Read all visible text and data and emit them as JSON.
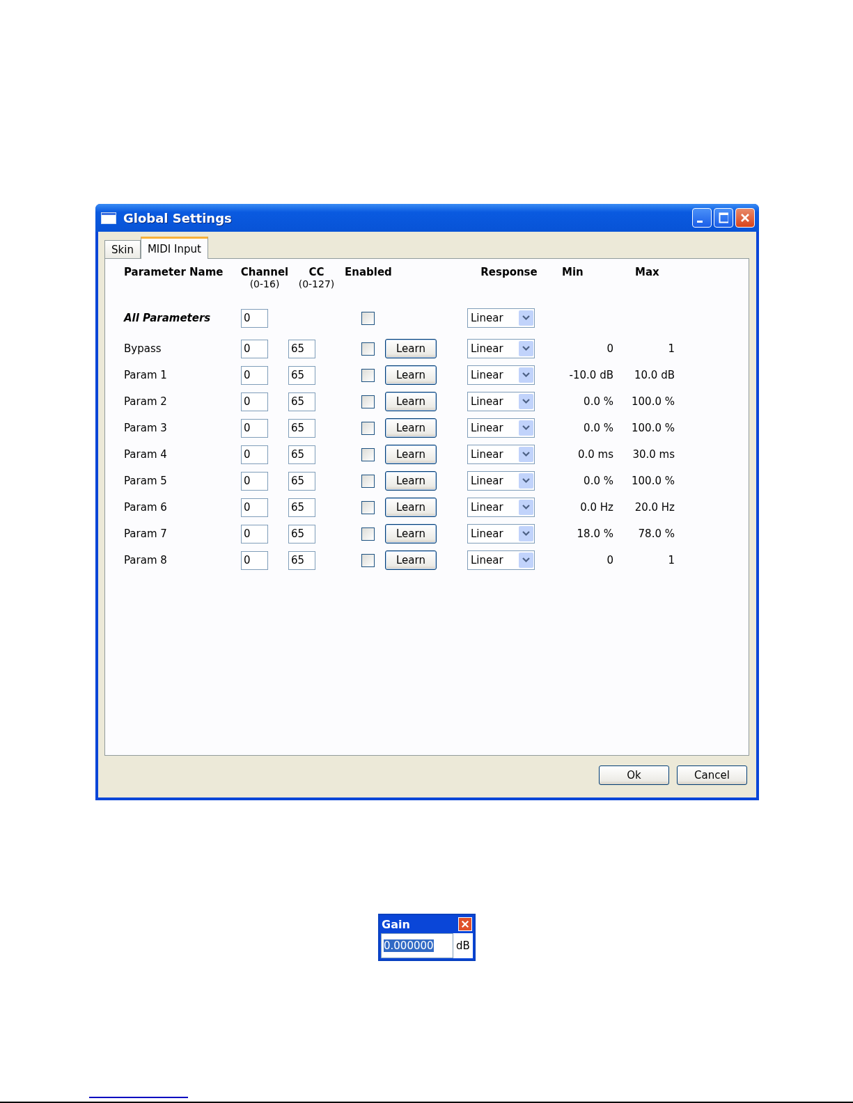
{
  "window": {
    "title": "Global Settings"
  },
  "tabs": [
    {
      "label": "Skin",
      "selected": false
    },
    {
      "label": "MIDI Input",
      "selected": true
    }
  ],
  "columns": [
    {
      "label": "Parameter Name"
    },
    {
      "label": "Channel",
      "sub": "(0-16)"
    },
    {
      "label": "CC",
      "sub": "(0-127)"
    },
    {
      "label": "Enabled"
    },
    {
      "label": "Response"
    },
    {
      "label": "Min"
    },
    {
      "label": "Max"
    }
  ],
  "rows": [
    {
      "kind": "all",
      "name": "All Parameters",
      "channel": "0",
      "enabled": false,
      "response": "Linear"
    },
    {
      "kind": "param",
      "name": "Bypass",
      "channel": "0",
      "cc": "65",
      "enabled": false,
      "learn": "Learn",
      "response": "Linear",
      "min": "0",
      "max": "1"
    },
    {
      "kind": "param",
      "name": "Param 1",
      "channel": "0",
      "cc": "65",
      "enabled": false,
      "learn": "Learn",
      "response": "Linear",
      "min": "-10.0 dB",
      "max": "10.0 dB"
    },
    {
      "kind": "param",
      "name": "Param 2",
      "channel": "0",
      "cc": "65",
      "enabled": false,
      "learn": "Learn",
      "response": "Linear",
      "min": "0.0 %",
      "max": "100.0 %"
    },
    {
      "kind": "param",
      "name": "Param 3",
      "channel": "0",
      "cc": "65",
      "enabled": false,
      "learn": "Learn",
      "response": "Linear",
      "min": "0.0 %",
      "max": "100.0 %"
    },
    {
      "kind": "param",
      "name": "Param 4",
      "channel": "0",
      "cc": "65",
      "enabled": false,
      "learn": "Learn",
      "response": "Linear",
      "min": "0.0 ms",
      "max": "30.0 ms"
    },
    {
      "kind": "param",
      "name": "Param 5",
      "channel": "0",
      "cc": "65",
      "enabled": false,
      "learn": "Learn",
      "response": "Linear",
      "min": "0.0 %",
      "max": "100.0 %"
    },
    {
      "kind": "param",
      "name": "Param 6",
      "channel": "0",
      "cc": "65",
      "enabled": false,
      "learn": "Learn",
      "response": "Linear",
      "min": "0.0 Hz",
      "max": "20.0 Hz"
    },
    {
      "kind": "param",
      "name": "Param 7",
      "channel": "0",
      "cc": "65",
      "enabled": false,
      "learn": "Learn",
      "response": "Linear",
      "min": "18.0 %",
      "max": "78.0 %"
    },
    {
      "kind": "param",
      "name": "Param 8",
      "channel": "0",
      "cc": "65",
      "enabled": false,
      "learn": "Learn",
      "response": "Linear",
      "min": "0",
      "max": "1"
    }
  ],
  "buttons": [
    "Ok",
    "Cancel"
  ],
  "gain_window": {
    "title": "Gain",
    "value": "0.000000",
    "selected": true,
    "unit": "dB"
  }
}
